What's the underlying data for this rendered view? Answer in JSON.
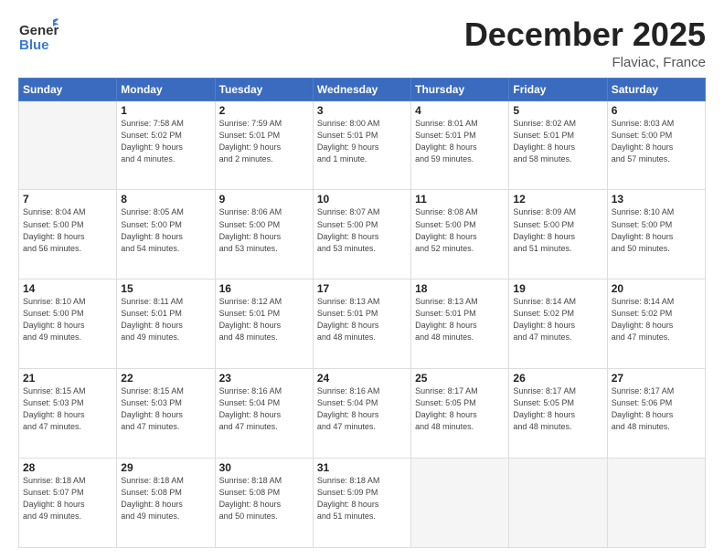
{
  "header": {
    "logo_general": "General",
    "logo_blue": "Blue",
    "main_title": "December 2025",
    "subtitle": "Flaviac, France"
  },
  "calendar": {
    "columns": [
      "Sunday",
      "Monday",
      "Tuesday",
      "Wednesday",
      "Thursday",
      "Friday",
      "Saturday"
    ],
    "weeks": [
      [
        {
          "day": "",
          "info": ""
        },
        {
          "day": "1",
          "info": "Sunrise: 7:58 AM\nSunset: 5:02 PM\nDaylight: 9 hours\nand 4 minutes."
        },
        {
          "day": "2",
          "info": "Sunrise: 7:59 AM\nSunset: 5:01 PM\nDaylight: 9 hours\nand 2 minutes."
        },
        {
          "day": "3",
          "info": "Sunrise: 8:00 AM\nSunset: 5:01 PM\nDaylight: 9 hours\nand 1 minute."
        },
        {
          "day": "4",
          "info": "Sunrise: 8:01 AM\nSunset: 5:01 PM\nDaylight: 8 hours\nand 59 minutes."
        },
        {
          "day": "5",
          "info": "Sunrise: 8:02 AM\nSunset: 5:01 PM\nDaylight: 8 hours\nand 58 minutes."
        },
        {
          "day": "6",
          "info": "Sunrise: 8:03 AM\nSunset: 5:00 PM\nDaylight: 8 hours\nand 57 minutes."
        }
      ],
      [
        {
          "day": "7",
          "info": "Sunrise: 8:04 AM\nSunset: 5:00 PM\nDaylight: 8 hours\nand 56 minutes."
        },
        {
          "day": "8",
          "info": "Sunrise: 8:05 AM\nSunset: 5:00 PM\nDaylight: 8 hours\nand 54 minutes."
        },
        {
          "day": "9",
          "info": "Sunrise: 8:06 AM\nSunset: 5:00 PM\nDaylight: 8 hours\nand 53 minutes."
        },
        {
          "day": "10",
          "info": "Sunrise: 8:07 AM\nSunset: 5:00 PM\nDaylight: 8 hours\nand 53 minutes."
        },
        {
          "day": "11",
          "info": "Sunrise: 8:08 AM\nSunset: 5:00 PM\nDaylight: 8 hours\nand 52 minutes."
        },
        {
          "day": "12",
          "info": "Sunrise: 8:09 AM\nSunset: 5:00 PM\nDaylight: 8 hours\nand 51 minutes."
        },
        {
          "day": "13",
          "info": "Sunrise: 8:10 AM\nSunset: 5:00 PM\nDaylight: 8 hours\nand 50 minutes."
        }
      ],
      [
        {
          "day": "14",
          "info": "Sunrise: 8:10 AM\nSunset: 5:00 PM\nDaylight: 8 hours\nand 49 minutes."
        },
        {
          "day": "15",
          "info": "Sunrise: 8:11 AM\nSunset: 5:01 PM\nDaylight: 8 hours\nand 49 minutes."
        },
        {
          "day": "16",
          "info": "Sunrise: 8:12 AM\nSunset: 5:01 PM\nDaylight: 8 hours\nand 48 minutes."
        },
        {
          "day": "17",
          "info": "Sunrise: 8:13 AM\nSunset: 5:01 PM\nDaylight: 8 hours\nand 48 minutes."
        },
        {
          "day": "18",
          "info": "Sunrise: 8:13 AM\nSunset: 5:01 PM\nDaylight: 8 hours\nand 48 minutes."
        },
        {
          "day": "19",
          "info": "Sunrise: 8:14 AM\nSunset: 5:02 PM\nDaylight: 8 hours\nand 47 minutes."
        },
        {
          "day": "20",
          "info": "Sunrise: 8:14 AM\nSunset: 5:02 PM\nDaylight: 8 hours\nand 47 minutes."
        }
      ],
      [
        {
          "day": "21",
          "info": "Sunrise: 8:15 AM\nSunset: 5:03 PM\nDaylight: 8 hours\nand 47 minutes."
        },
        {
          "day": "22",
          "info": "Sunrise: 8:15 AM\nSunset: 5:03 PM\nDaylight: 8 hours\nand 47 minutes."
        },
        {
          "day": "23",
          "info": "Sunrise: 8:16 AM\nSunset: 5:04 PM\nDaylight: 8 hours\nand 47 minutes."
        },
        {
          "day": "24",
          "info": "Sunrise: 8:16 AM\nSunset: 5:04 PM\nDaylight: 8 hours\nand 47 minutes."
        },
        {
          "day": "25",
          "info": "Sunrise: 8:17 AM\nSunset: 5:05 PM\nDaylight: 8 hours\nand 48 minutes."
        },
        {
          "day": "26",
          "info": "Sunrise: 8:17 AM\nSunset: 5:05 PM\nDaylight: 8 hours\nand 48 minutes."
        },
        {
          "day": "27",
          "info": "Sunrise: 8:17 AM\nSunset: 5:06 PM\nDaylight: 8 hours\nand 48 minutes."
        }
      ],
      [
        {
          "day": "28",
          "info": "Sunrise: 8:18 AM\nSunset: 5:07 PM\nDaylight: 8 hours\nand 49 minutes."
        },
        {
          "day": "29",
          "info": "Sunrise: 8:18 AM\nSunset: 5:08 PM\nDaylight: 8 hours\nand 49 minutes."
        },
        {
          "day": "30",
          "info": "Sunrise: 8:18 AM\nSunset: 5:08 PM\nDaylight: 8 hours\nand 50 minutes."
        },
        {
          "day": "31",
          "info": "Sunrise: 8:18 AM\nSunset: 5:09 PM\nDaylight: 8 hours\nand 51 minutes."
        },
        {
          "day": "",
          "info": ""
        },
        {
          "day": "",
          "info": ""
        },
        {
          "day": "",
          "info": ""
        }
      ]
    ]
  }
}
